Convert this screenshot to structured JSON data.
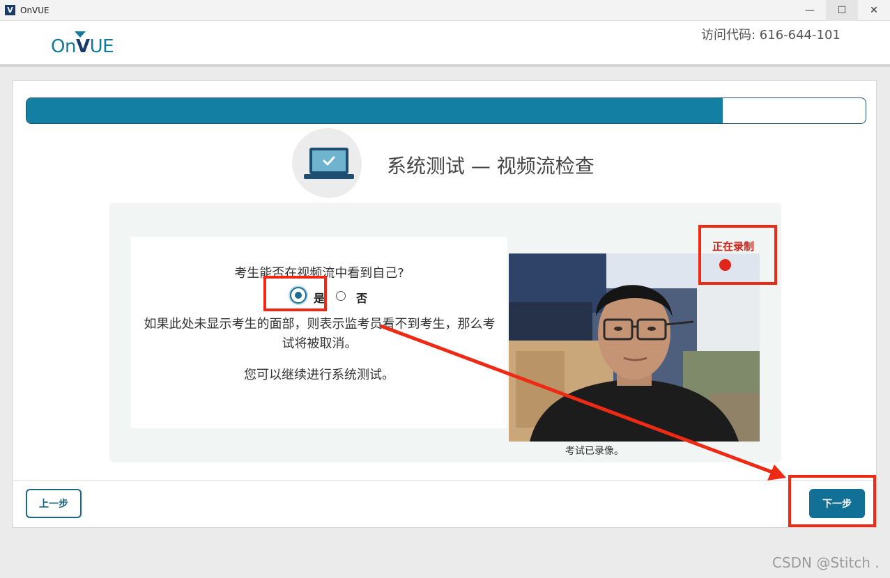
{
  "window": {
    "app_icon_letter": "V",
    "title": "OnVUE",
    "min_icon": "minimize-icon",
    "max_icon": "maximize-icon",
    "close_icon": "close-icon",
    "min_glyph": "—",
    "max_glyph": "☐",
    "close_glyph": "✕"
  },
  "header": {
    "logo_prefix": "On",
    "logo_v": "V",
    "logo_suffix": "UE",
    "access_code": "访问代码: 616-644-101"
  },
  "progress": {
    "value_percent": 83
  },
  "page": {
    "title": "系统测试 — 视频流检查",
    "question": "考生能否在视频流中看到自己?",
    "options": [
      {
        "label": "是",
        "selected": true
      },
      {
        "label": "否",
        "selected": false
      }
    ],
    "description": "如果此处未显示考生的面部，则表示监考员看不到考生，那么考试将被取消。",
    "continue_text": "您可以继续进行系统测试。",
    "recording_label": "正在录制",
    "recorded_caption": "考试已录像。"
  },
  "footer": {
    "prev_label": "上一步",
    "next_label": "下一步"
  },
  "watermark": "CSDN @Stitch .",
  "colors": {
    "accent": "#127fa3",
    "brand_dark": "#173b6b",
    "annotation_red": "#ee2a14",
    "recording_red": "#e0261a"
  }
}
